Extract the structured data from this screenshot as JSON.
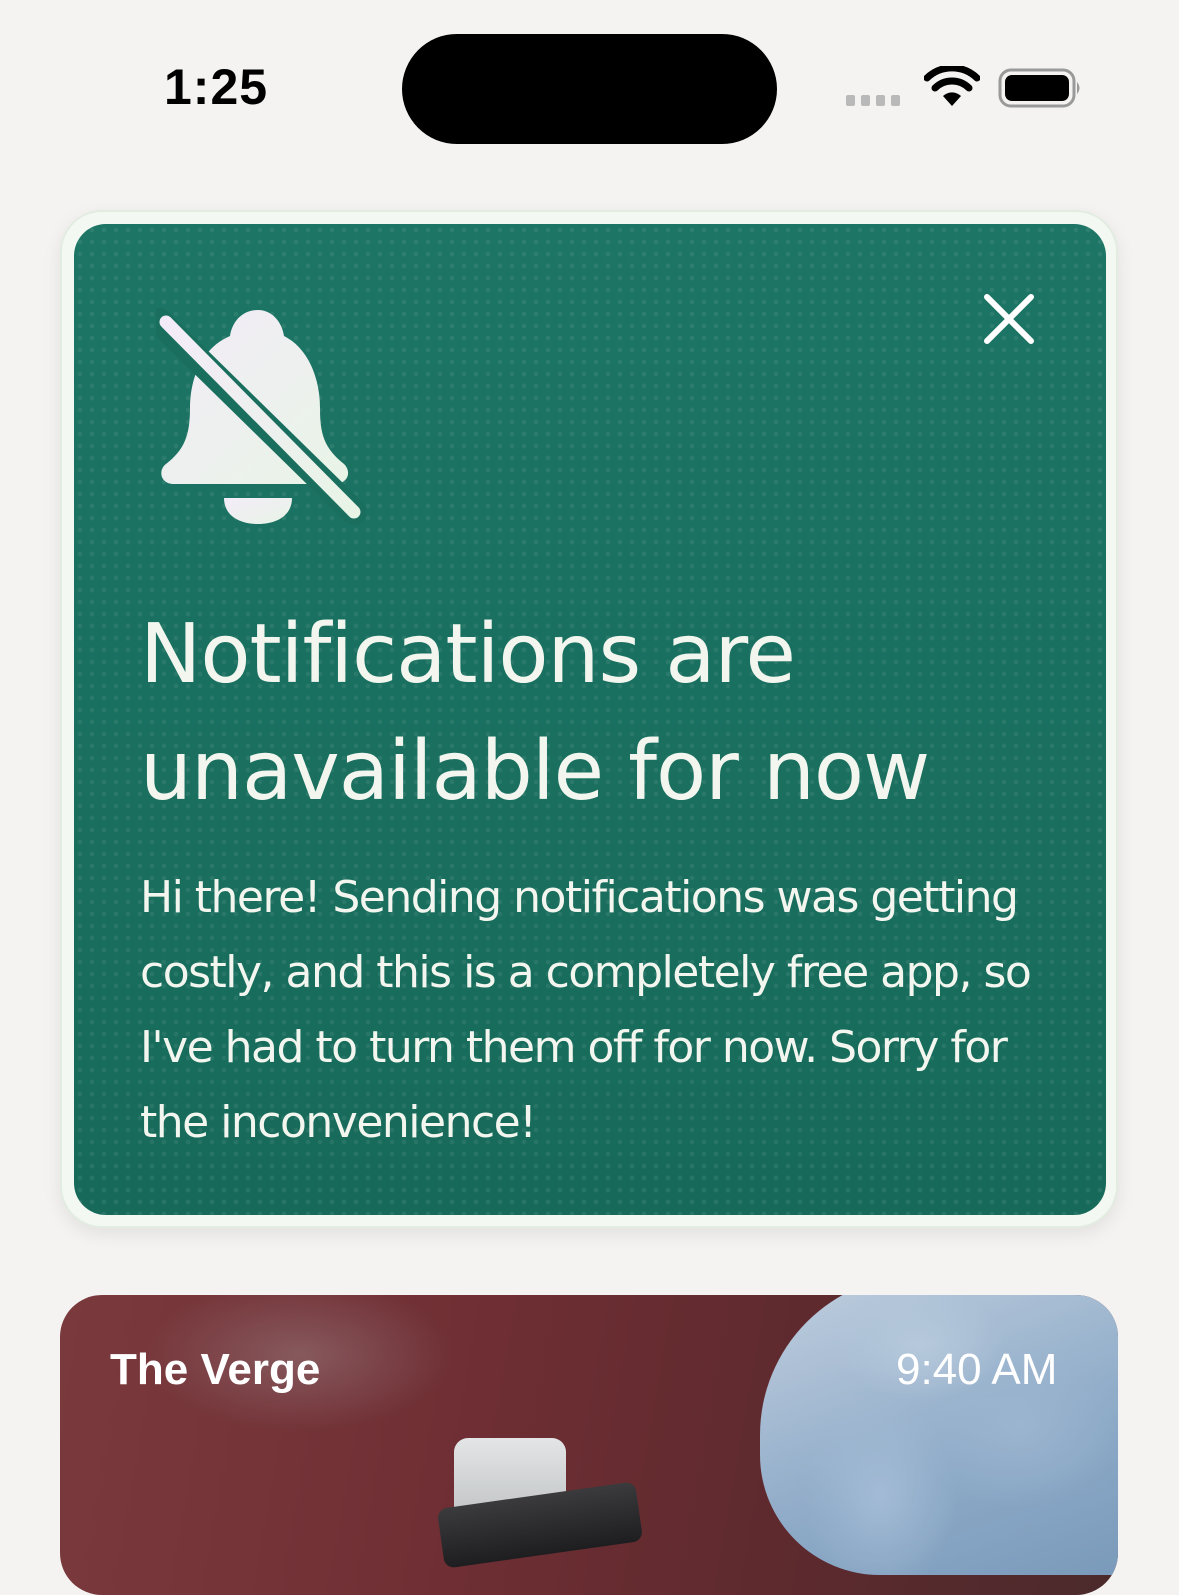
{
  "status_bar": {
    "time": "1:25"
  },
  "notice": {
    "title": "Notifications are unavailable for now",
    "body": "Hi there! Sending notifications was getting costly, and this is a completely free app, so I've had to turn them off for now. Sorry for the inconvenience!",
    "icon": "bell-slash-icon",
    "close_icon": "close-icon",
    "bg_color": "#1a6e5e"
  },
  "article": {
    "source": "The Verge",
    "time": "9:40 AM"
  }
}
